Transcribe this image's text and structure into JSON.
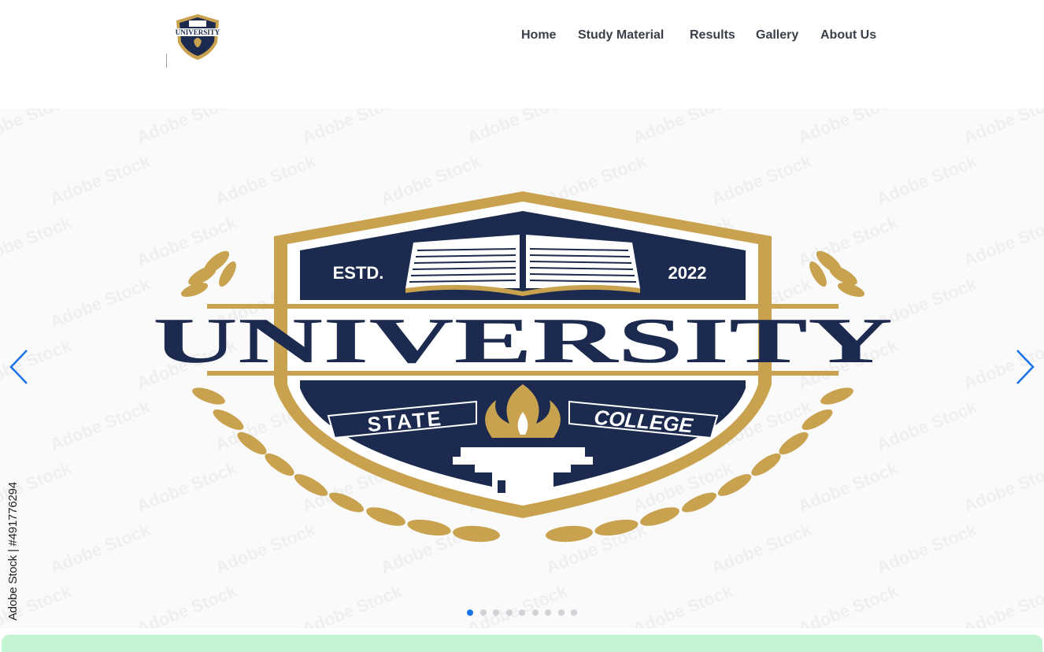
{
  "header": {
    "logo_text": "UNIVERSITY",
    "nav": [
      {
        "label": "Home"
      },
      {
        "label": "Study Material"
      },
      {
        "label": "Results"
      },
      {
        "label": "Gallery"
      },
      {
        "label": "About Us"
      }
    ]
  },
  "slide": {
    "estd_label": "ESTD.",
    "year": "2022",
    "title": "UNIVERSITY",
    "ribbon_left": "STATE",
    "ribbon_right": "COLLEGE",
    "credit": "Adobe Stock | #491776294",
    "watermark": "Adobe Stock"
  },
  "carousel": {
    "slide_count": 9,
    "active_index": 0,
    "prev_icon": "chevron-left-icon",
    "next_icon": "chevron-right-icon"
  },
  "colors": {
    "navy": "#1b2a4e",
    "gold": "#c9a24f",
    "arrow_blue": "#1a73e8",
    "nav_text": "#3a3f4a",
    "bottom_bar": "#c3f5d3"
  }
}
